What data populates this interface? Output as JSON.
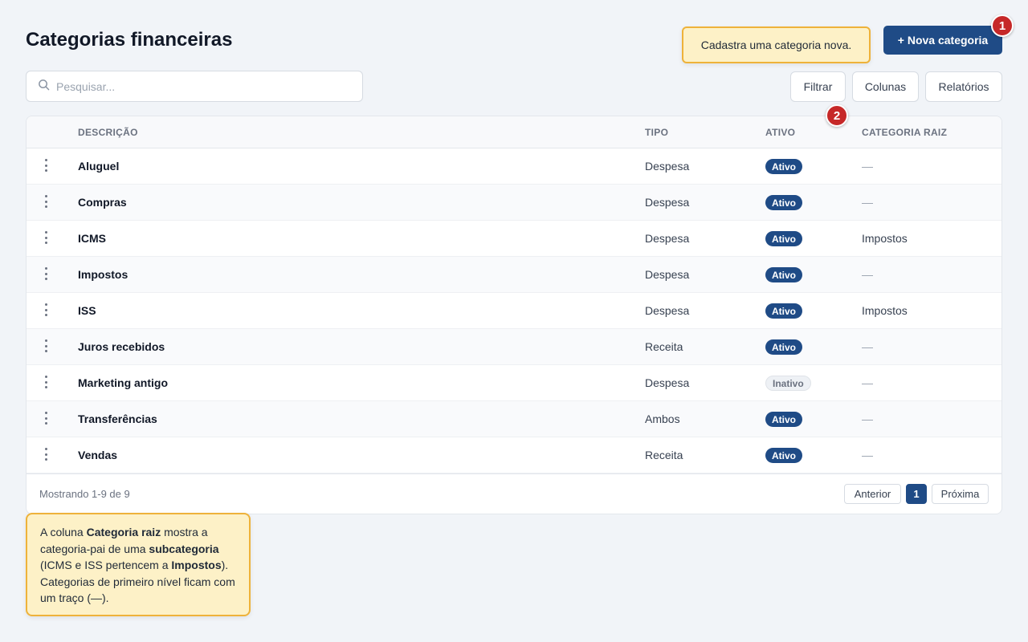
{
  "page": {
    "title": "Categorias financeiras"
  },
  "header": {
    "new_button_label": "+ Nova categoria",
    "tooltip_new": "Cadastra uma categoria nova."
  },
  "markers": [
    "1",
    "2"
  ],
  "search": {
    "placeholder": "Pesquisar...",
    "value": ""
  },
  "toolbar": {
    "filter_label": "Filtrar",
    "columns_label": "Colunas",
    "reports_label": "Relatórios"
  },
  "table": {
    "headers": {
      "description": "DESCRIÇÃO",
      "type": "TIPO",
      "active": "ATIVO",
      "root": "CATEGORIA RAIZ"
    },
    "rows": [
      {
        "description": "Aluguel",
        "type": "Despesa",
        "status": "Ativo",
        "root": "—"
      },
      {
        "description": "Compras",
        "type": "Despesa",
        "status": "Ativo",
        "root": "—"
      },
      {
        "description": "ICMS",
        "type": "Despesa",
        "status": "Ativo",
        "root": "Impostos"
      },
      {
        "description": "Impostos",
        "type": "Despesa",
        "status": "Ativo",
        "root": "—"
      },
      {
        "description": "ISS",
        "type": "Despesa",
        "status": "Ativo",
        "root": "Impostos"
      },
      {
        "description": "Juros recebidos",
        "type": "Receita",
        "status": "Ativo",
        "root": "—"
      },
      {
        "description": "Marketing antigo",
        "type": "Despesa",
        "status": "Inativo",
        "root": "—"
      },
      {
        "description": "Transferências",
        "type": "Ambos",
        "status": "Ativo",
        "root": "—"
      },
      {
        "description": "Vendas",
        "type": "Receita",
        "status": "Ativo",
        "root": "—"
      }
    ]
  },
  "pagination": {
    "showing": "Mostrando 1-9 de 9",
    "prev": "Anterior",
    "current": "1",
    "next": "Próxima"
  },
  "tooltip_root": {
    "t1": "A coluna ",
    "b1": "Categoria raiz",
    "t2": " mostra a categoria-pai de uma ",
    "b2": "subcategoria",
    "t3": " (ICMS e ISS pertencem a ",
    "b3": "Impostos",
    "t4": "). Categorias de primeiro nível ficam com um traço (—)."
  },
  "colors": {
    "primary": "#1f4b86",
    "tooltip_bg": "#fdf1c7",
    "tooltip_border": "#eeb23a",
    "marker": "#c62828"
  }
}
